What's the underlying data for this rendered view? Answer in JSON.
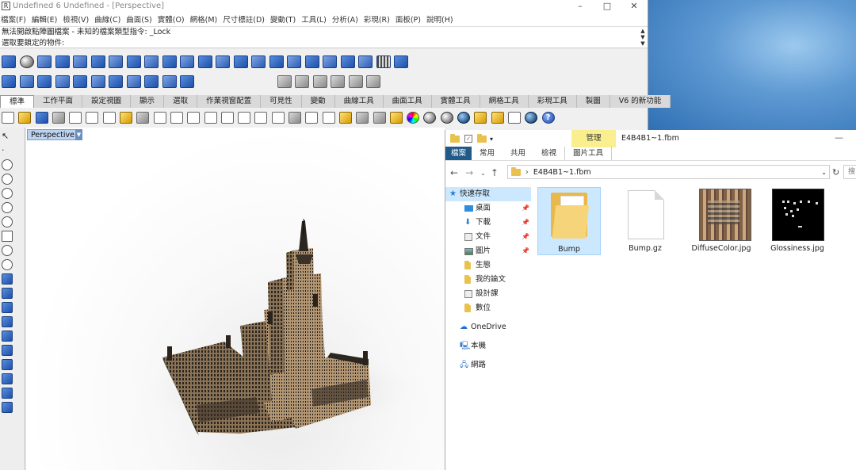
{
  "rhino": {
    "title": "Undefined 6 Undefined - [Perspective]",
    "window_controls": [
      "–",
      "□",
      "✕"
    ],
    "menu": [
      "檔案(F)",
      "編輯(E)",
      "檢視(V)",
      "曲線(C)",
      "曲面(S)",
      "實體(O)",
      "網格(M)",
      "尺寸標註(D)",
      "變動(T)",
      "工具(L)",
      "分析(A)",
      "彩現(R)",
      "面板(P)",
      "說明(H)"
    ],
    "command_history": "無法開啟點陣圖檔案 - 未知的檔案類型指令: _Lock",
    "command_prompt": "選取要鎖定的物件:",
    "tabs": [
      "標準",
      "工作平面",
      "設定視圖",
      "顯示",
      "選取",
      "作業視窗配置",
      "可見性",
      "變動",
      "曲線工具",
      "曲面工具",
      "實體工具",
      "網格工具",
      "彩現工具",
      "製圖",
      "V6 的新功能"
    ],
    "active_tab": "標準",
    "viewport_label": "Perspective",
    "accent": "#bcd3ef"
  },
  "explorer": {
    "manage_label": "管理",
    "window_name": "E4B4B1~1.fbm",
    "minimize": "—",
    "ribbon_tabs": [
      "檔案",
      "常用",
      "共用",
      "檢視",
      "圖片工具"
    ],
    "address": "E4B4B1~1.fbm",
    "search_placeholder": "搜",
    "nav": {
      "quick_access": "快速存取",
      "items": [
        {
          "label": "桌面",
          "pinned": true
        },
        {
          "label": "下載",
          "pinned": true
        },
        {
          "label": "文件",
          "pinned": true
        },
        {
          "label": "圖片",
          "pinned": true
        },
        {
          "label": "生態",
          "pinned": false
        },
        {
          "label": "我的論文",
          "pinned": false
        },
        {
          "label": "設計課",
          "pinned": false
        },
        {
          "label": "數位",
          "pinned": false
        }
      ],
      "onedrive": "OneDrive",
      "this_pc": "本機",
      "network": "網路"
    },
    "files": [
      {
        "name": "Bump",
        "type": "folder",
        "selected": true
      },
      {
        "name": "Bump.gz",
        "type": "file",
        "selected": false
      },
      {
        "name": "DiffuseColor.jpg",
        "type": "image",
        "selected": false
      },
      {
        "name": "Glossiness.jpg",
        "type": "image",
        "selected": false
      }
    ],
    "selection_color": "#cce8ff",
    "file_tab_color": "#205a88"
  }
}
